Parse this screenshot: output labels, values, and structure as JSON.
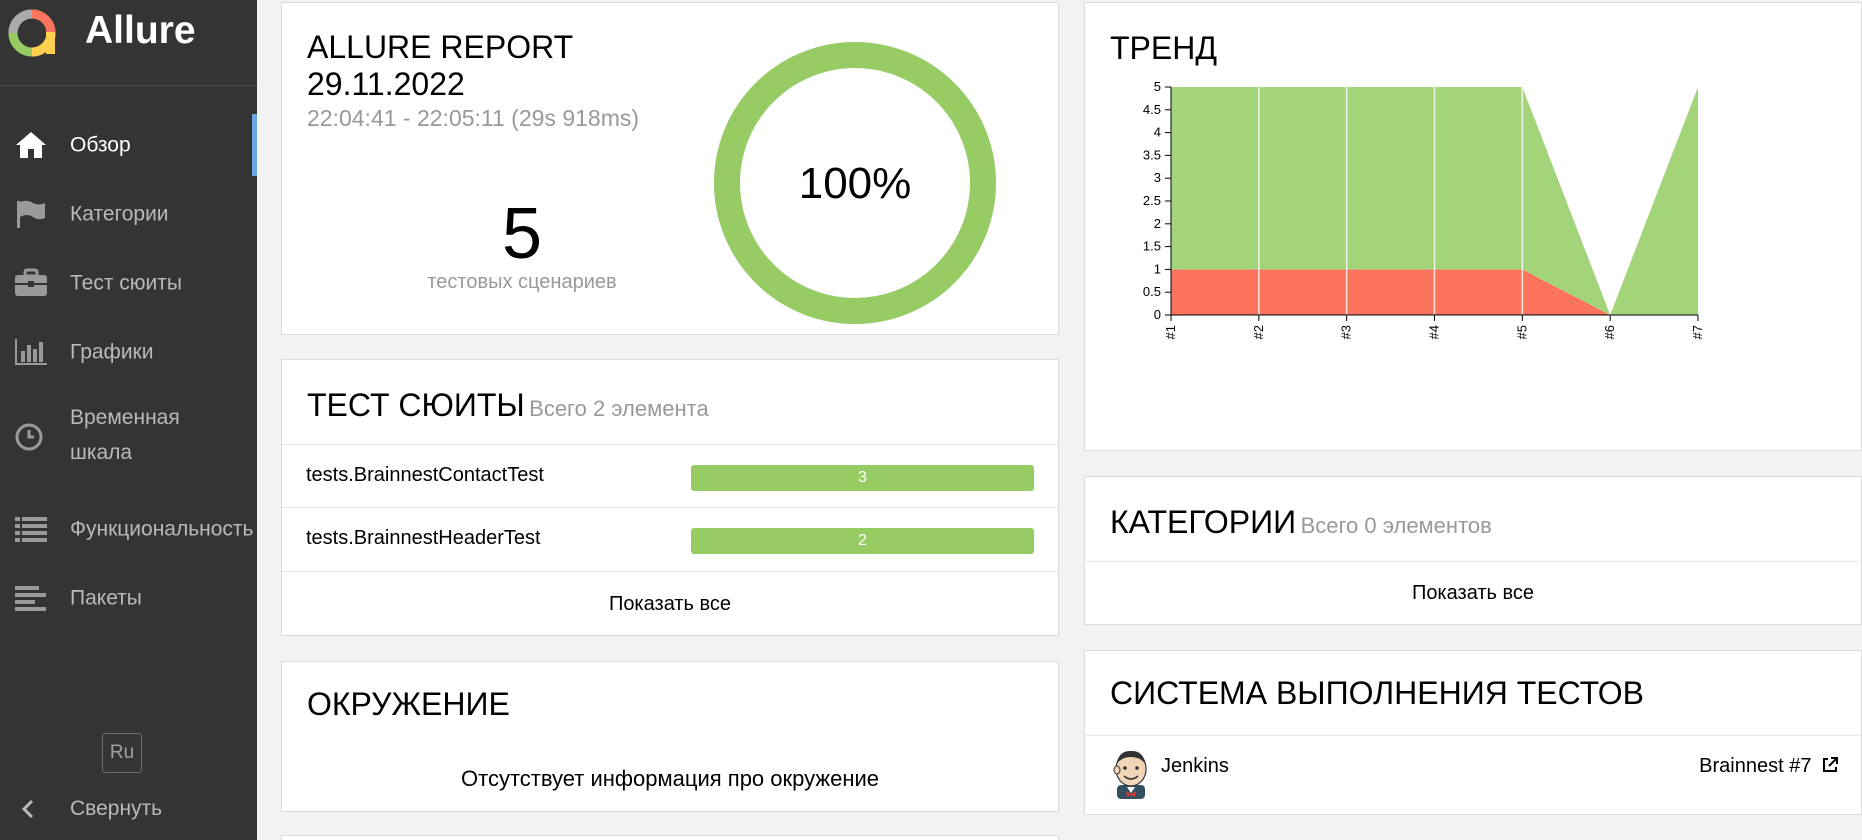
{
  "app": {
    "name": "Allure"
  },
  "sidebar": {
    "items": [
      {
        "label": "Обзор",
        "icon": "home-icon"
      },
      {
        "label": "Категории",
        "icon": "flag-icon"
      },
      {
        "label": "Тест сюиты",
        "icon": "briefcase-icon"
      },
      {
        "label": "Графики",
        "icon": "bar-chart-icon"
      },
      {
        "label": "Временная шкала",
        "icon": "clock-icon"
      },
      {
        "label": "Функциональность",
        "icon": "list-icon"
      },
      {
        "label": "Пакеты",
        "icon": "align-left-icon"
      }
    ],
    "language": "Ru",
    "collapse_label": "Свернуть"
  },
  "summary": {
    "title_line1": "ALLURE REPORT",
    "title_line2": "29.11.2022",
    "time_range": "22:04:41 - 22:05:11 (29s 918ms)",
    "test_count": "5",
    "test_count_label": "тестовых сценариев",
    "success_rate": "100%",
    "success_fraction": 1.0
  },
  "suites": {
    "title": "ТЕСТ СЮИТЫ",
    "subtitle": "Всего 2 элемента",
    "rows": [
      {
        "name": "tests.BrainnestContactTest",
        "count": "3"
      },
      {
        "name": "tests.BrainnestHeaderTest",
        "count": "2"
      }
    ],
    "show_all": "Показать все"
  },
  "environment": {
    "title": "ОКРУЖЕНИЕ",
    "empty_text": "Отсутствует информация про окружение"
  },
  "trend": {
    "title": "ТРЕНД"
  },
  "categories": {
    "title": "КАТЕГОРИИ",
    "subtitle": "Всего 0 элементов",
    "show_all": "Показать все"
  },
  "executors": {
    "title": "СИСТЕМА ВЫПОЛНЕНИЯ ТЕСТОВ",
    "name": "Jenkins",
    "build": "Brainnest #7"
  },
  "colors": {
    "passed": "#97cc64",
    "failed": "#fd745e",
    "sidebar": "#343434",
    "active_accent": "#6aa6e6"
  },
  "chart_data": {
    "type": "area",
    "x": [
      "#1",
      "#2",
      "#3",
      "#4",
      "#5",
      "#6",
      "#7"
    ],
    "series": [
      {
        "color": "#fd745e",
        "values": [
          1,
          1,
          1,
          1,
          1,
          0,
          0
        ]
      },
      {
        "color": "#a3d47a",
        "values": [
          4,
          4,
          4,
          4,
          4,
          0,
          5
        ]
      }
    ],
    "stacked": true,
    "ylim": [
      0,
      5
    ],
    "yticks": [
      "0",
      "0.5",
      "1",
      "1.5",
      "2",
      "2.5",
      "3",
      "3.5",
      "4",
      "4.5",
      "5"
    ],
    "grid": "vertical"
  }
}
